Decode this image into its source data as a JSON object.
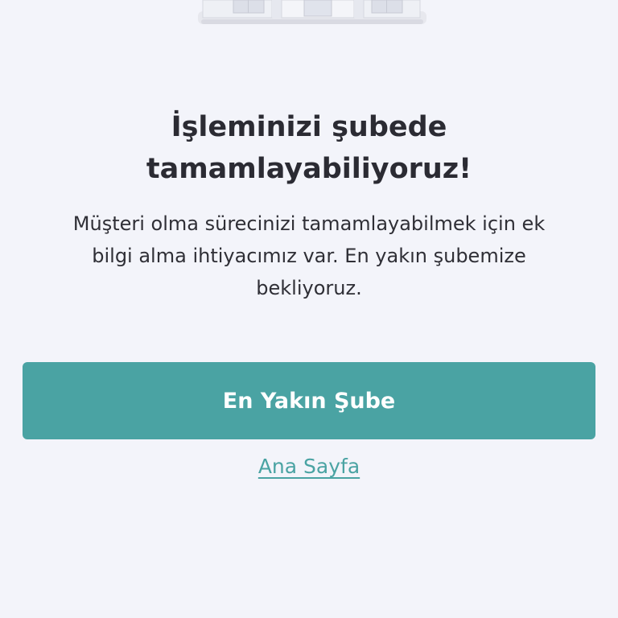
{
  "illustration": {
    "icon": "building-icon"
  },
  "title": {
    "line1": "İşleminizi şubede",
    "line2": "tamamlayabiliyoruz!"
  },
  "description": {
    "line1": "Müşteri olma sürecinizi tamamlayabilmek için ek",
    "line2": "bilgi alma ihtiyacımız var. En yakın şubemize",
    "line3": "bekliyoruz."
  },
  "actions": {
    "primary_label": "En Yakın Şube",
    "home_label": "Ana Sayfa"
  },
  "colors": {
    "background": "#f3f4fa",
    "accent": "#4aa3a3",
    "text": "#2b2b33"
  }
}
